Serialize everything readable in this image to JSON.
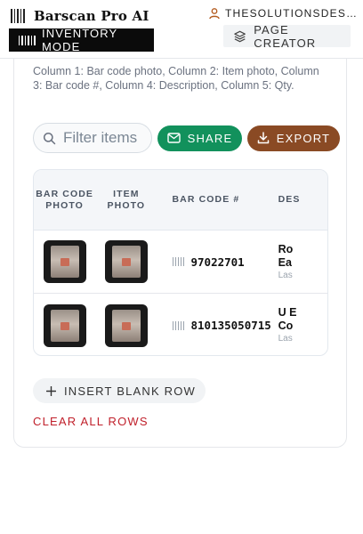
{
  "header": {
    "app_title": "Barscan Pro AI",
    "user_name": "THESOLUTIONSDES…",
    "mode_button_label": "INVENTORY MODE",
    "page_creator_label": "PAGE CREATOR"
  },
  "card": {
    "description": "Column 1: Bar code photo, Column 2: Item photo, Column 3: Bar code #, Column 4: Description, Column 5: Qty."
  },
  "toolbar": {
    "search_placeholder": "Filter items",
    "share_label": "SHARE",
    "export_label": "EXPORT"
  },
  "table": {
    "headers": [
      "BAR CODE PHOTO",
      "ITEM PHOTO",
      "BAR CODE #",
      "DES"
    ],
    "rows": [
      {
        "barcode": "97022701",
        "desc_title": "Ro",
        "desc_title2": "Ea",
        "desc_sub": "Las"
      },
      {
        "barcode": "810135050715",
        "desc_title": "U E",
        "desc_title2": "Co",
        "desc_sub": "Las"
      }
    ]
  },
  "actions": {
    "insert_label": "INSERT BLANK ROW",
    "clear_label": "CLEAR ALL ROWS"
  },
  "colors": {
    "share": "#12915c",
    "export": "#8a4a24",
    "clear": "#c0202b",
    "mode_bg": "#0b0b0b"
  },
  "icons": [
    "barcode-icon",
    "user-icon",
    "layers-icon",
    "search-icon",
    "mail-icon",
    "download-icon",
    "plus-icon"
  ]
}
